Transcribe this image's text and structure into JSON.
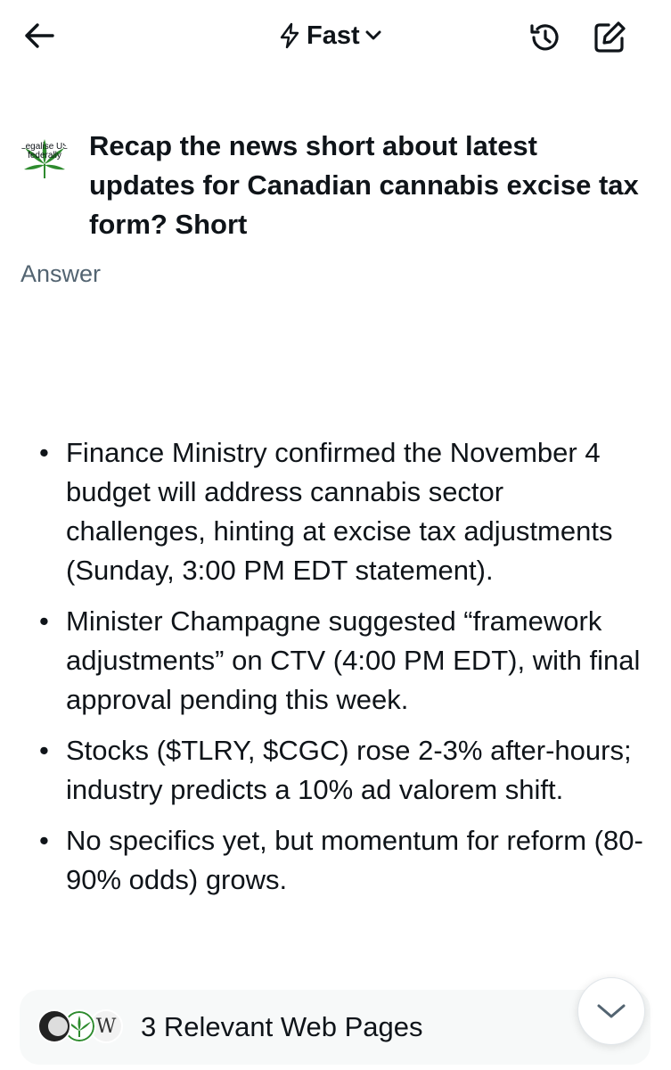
{
  "header": {
    "model_label": "Fast"
  },
  "question": {
    "text": "Recap the news short about latest updates for Canadian cannabis excise tax form? Short",
    "avatar_text": "Legalise US federally"
  },
  "answer_label": "Answer",
  "bullets": [
    "Finance Ministry confirmed the November 4 budget will address cannabis sector challenges, hinting at excise tax adjustments (Sunday, 3:00 PM EDT statement).",
    "Minister Champagne suggested “framework adjustments” on CTV (4:00 PM EDT), with final approval pending this week.",
    "Stocks ($TLRY, $CGC) rose 2-3% after-hours; industry predicts a 10% ad valorem shift.",
    "No specifics yet, but momentum for reform (80-90% odds) grows."
  ],
  "sources": {
    "label": "3 Relevant Web Pages",
    "icons": [
      "dark-circle-icon",
      "cannabis-leaf-icon",
      "wikipedia-w-icon"
    ],
    "wiki_letter": "W"
  },
  "colors": {
    "text": "#0f1419",
    "muted": "#536471",
    "sources_bg": "#f7f9f9",
    "leaf_green": "#2e8b2e"
  }
}
